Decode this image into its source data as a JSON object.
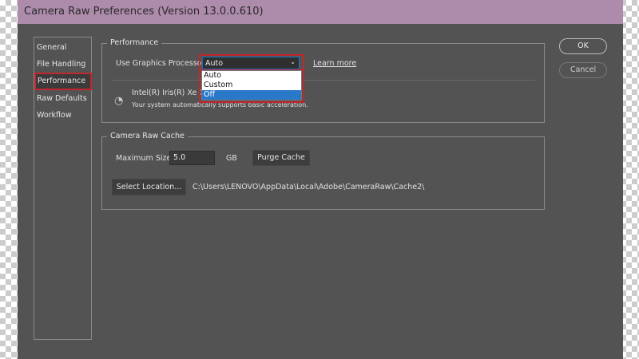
{
  "window": {
    "title": "Camera Raw Preferences  (Version 13.0.0.610)"
  },
  "sidebar": {
    "items": [
      {
        "label": "General"
      },
      {
        "label": "File Handling"
      },
      {
        "label": "Performance"
      },
      {
        "label": "Raw Defaults"
      },
      {
        "label": "Workflow"
      }
    ]
  },
  "performance": {
    "heading": "Performance",
    "gpu_label": "Use Graphics Processor:",
    "gpu_value": "Auto",
    "options": [
      "Auto",
      "Custom",
      "Off"
    ],
    "learn_more": "Learn more",
    "gpu_name": "Intel(R) Iris(R) Xe Gr",
    "gpu_status": "Your system automatically supports basic acceleration."
  },
  "cache": {
    "heading": "Camera Raw Cache",
    "max_size_label": "Maximum Size:",
    "max_size_value": "5.0",
    "unit": "GB",
    "purge": "Purge Cache",
    "select_location": "Select Location...",
    "path": "C:\\Users\\LENOVO\\AppData\\Local\\Adobe\\CameraRaw\\Cache2\\"
  },
  "buttons": {
    "ok": "OK",
    "cancel": "Cancel"
  }
}
